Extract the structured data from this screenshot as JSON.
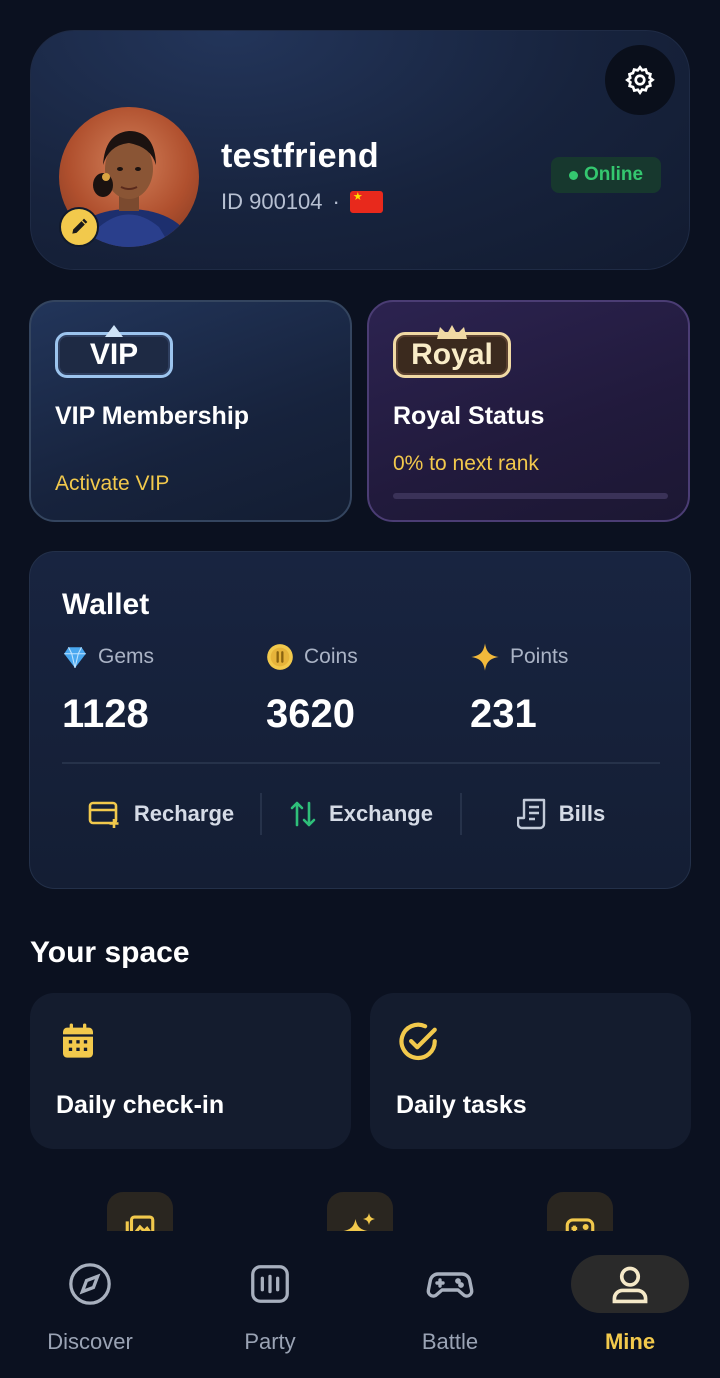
{
  "profile": {
    "username": "testfriend",
    "id_text": "ID 900104",
    "separator": "·",
    "status": "Online",
    "flag": "china-flag"
  },
  "vip": {
    "badge": "VIP",
    "title": "VIP Membership",
    "subtitle": "Activate VIP"
  },
  "royal": {
    "badge": "Royal",
    "title": "Royal Status",
    "subtitle": "0% to next rank",
    "progress_percent": 0
  },
  "wallet": {
    "title": "Wallet",
    "balances": [
      {
        "label": "Gems",
        "value": "1128",
        "icon": "gem-icon"
      },
      {
        "label": "Coins",
        "value": "3620",
        "icon": "coin-icon"
      },
      {
        "label": "Points",
        "value": "231",
        "icon": "sparkle-icon"
      }
    ],
    "actions": [
      {
        "label": "Recharge",
        "icon": "card-plus-icon"
      },
      {
        "label": "Exchange",
        "icon": "exchange-icon"
      },
      {
        "label": "Bills",
        "icon": "receipt-icon"
      }
    ]
  },
  "space": {
    "title": "Your space",
    "cards": [
      {
        "label": "Daily check-in",
        "icon": "calendar-icon"
      },
      {
        "label": "Daily tasks",
        "icon": "check-circle-icon"
      }
    ]
  },
  "nav": {
    "items": [
      {
        "label": "Discover",
        "icon": "compass-icon"
      },
      {
        "label": "Party",
        "icon": "party-icon"
      },
      {
        "label": "Battle",
        "icon": "gamepad-icon"
      },
      {
        "label": "Mine",
        "icon": "user-icon"
      }
    ],
    "active": "Mine"
  },
  "colors": {
    "background": "#0b1120",
    "accent": "#f2c94c",
    "online": "#34c76f"
  }
}
